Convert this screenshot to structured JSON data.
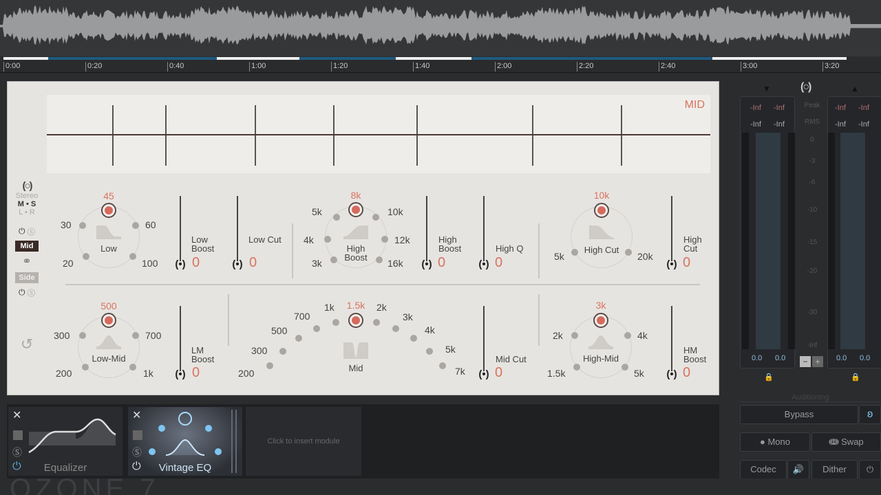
{
  "timeline": {
    "ticks": [
      "0:00",
      "0:20",
      "0:40",
      "1:00",
      "1:20",
      "1:40",
      "2:00",
      "2:20",
      "2:40",
      "3:00",
      "3:20"
    ]
  },
  "graph": {
    "channel_label": "MID"
  },
  "sidebar": {
    "stereo": "Stereo",
    "ms": "M • S",
    "lr": "L • R",
    "mid": "Mid",
    "side": "Side"
  },
  "bands": {
    "low": {
      "value": "45",
      "name": "Low",
      "labels": [
        "30",
        "60",
        "20",
        "100"
      ]
    },
    "high_boost": {
      "value": "8k",
      "name": "High\nBoost",
      "labels": [
        "5k",
        "10k",
        "4k",
        "12k",
        "3k",
        "16k"
      ]
    },
    "high_cut": {
      "value": "10k",
      "name": "High Cut",
      "labels": [
        "5k",
        "20k"
      ]
    },
    "low_mid": {
      "value": "500",
      "name": "Low-Mid",
      "labels": [
        "300",
        "700",
        "200",
        "1k"
      ]
    },
    "mid": {
      "value": "1.5k",
      "name": "Mid",
      "labels": [
        "200",
        "300",
        "500",
        "700",
        "1k",
        "2k",
        "3k",
        "4k",
        "5k",
        "7k"
      ]
    },
    "high_mid": {
      "value": "3k",
      "name": "High-Mid",
      "labels": [
        "2k",
        "4k",
        "1.5k",
        "5k"
      ]
    }
  },
  "sliders": [
    {
      "label": "Low Boost",
      "value": "0"
    },
    {
      "label": "Low Cut",
      "value": "0"
    },
    {
      "label": "High Boost",
      "value": "0"
    },
    {
      "label": "High Q",
      "value": "0"
    },
    {
      "label": "High Cut",
      "value": "0"
    },
    {
      "label": "LM Boost",
      "value": "0"
    },
    {
      "label": "Mid Cut",
      "value": "0"
    },
    {
      "label": "HM Boost",
      "value": "0"
    }
  ],
  "meters": {
    "peak_label": "Peak",
    "rms_label": "RMS",
    "in_peak": [
      "-Inf",
      "-Inf"
    ],
    "in_rms": [
      "-Inf",
      "-Inf"
    ],
    "out_peak": [
      "-Inf",
      "-Inf"
    ],
    "out_rms": [
      "-Inf",
      "-Inf"
    ],
    "scale": [
      "0",
      "-3",
      "-6",
      "-10",
      "-15",
      "-20",
      "-30",
      "-Inf"
    ],
    "in_gain": [
      "0.0",
      "0.0"
    ],
    "out_gain": [
      "0.0",
      "0.0"
    ]
  },
  "auditioning": {
    "title": "Auditioning",
    "bypass": "Bypass",
    "mono": "Mono",
    "swap": "Swap",
    "codec": "Codec",
    "dither": "Dither"
  },
  "modules": [
    {
      "name": "Equalizer"
    },
    {
      "name": "Vintage EQ"
    }
  ],
  "insert_label": "Click to insert module",
  "colors": {
    "accent": "#d9735f",
    "active_blue": "#7fc4f0"
  }
}
